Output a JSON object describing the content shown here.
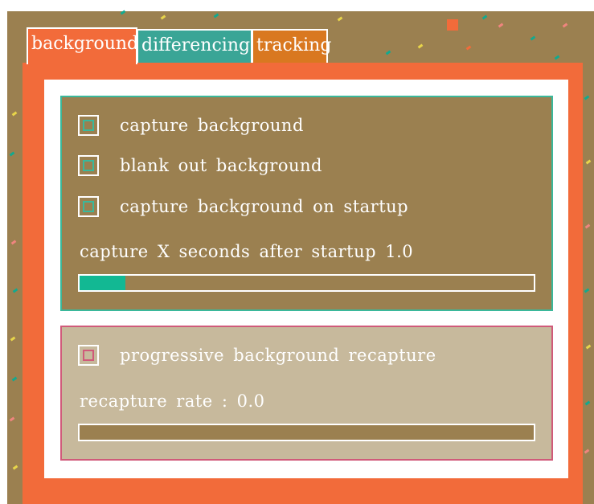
{
  "tabs": [
    {
      "label": "background"
    },
    {
      "label": "differencing"
    },
    {
      "label": "tracking"
    }
  ],
  "capture_group": {
    "capture_background": "capture background",
    "blank_out_background": "blank out background",
    "capture_on_startup": "capture background on startup",
    "seconds_label": "capture X seconds after startup 1.0",
    "seconds_slider_fraction": 0.1
  },
  "progressive_group": {
    "progressive_recapture": "progressive background recapture",
    "rate_label": "recapture rate : 0.0",
    "rate_slider_fraction": 0.0
  },
  "colors": {
    "background_tab": "#f26b3a",
    "differencing_tab": "#3aa596",
    "tracking_tab": "#d97820",
    "capture_group_bg": "#9b8050",
    "progressive_group_bg": "#c7b99c",
    "slider_fill": "#12b893"
  }
}
